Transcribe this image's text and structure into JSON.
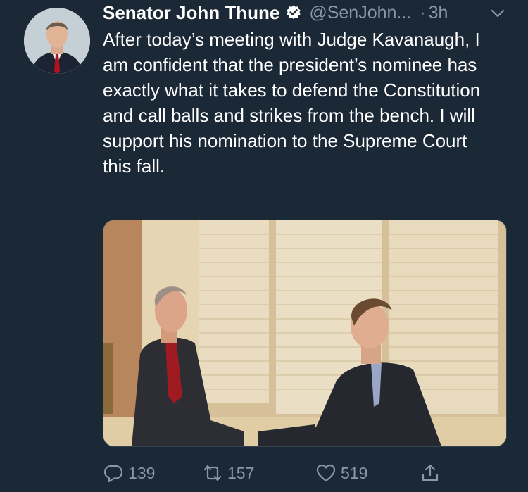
{
  "tweet": {
    "author_name": "Senator John Thune",
    "handle": "@SenJohn...",
    "separator": "·",
    "timestamp": "3h",
    "text": "After today’s meeting with Judge Kavanaugh, I am confident that the president’s nominee has exactly what it takes to defend the Constitution and call balls and strikes from the bench. I will support his nomination to the Supreme Court this fall.",
    "replies": "139",
    "retweets": "157",
    "likes": "519"
  },
  "icons": {
    "verified": "verified-badge-icon",
    "menu": "chevron-down-icon",
    "reply": "reply-icon",
    "retweet": "retweet-icon",
    "like": "heart-icon",
    "share": "share-icon"
  },
  "colors": {
    "background": "#1b2836",
    "text": "#ffffff",
    "secondary": "#8899a6"
  }
}
